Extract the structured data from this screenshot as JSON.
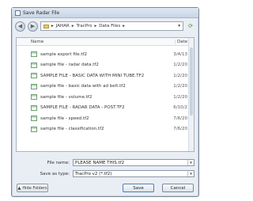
{
  "window": {
    "title": "Save Radar File"
  },
  "navbar": {
    "back_glyph": "◀",
    "forward_glyph": "▶",
    "breadcrumb": [
      "JAHAR",
      "TracPro",
      "Data Files"
    ],
    "separator": "▸",
    "dropdown_glyph": "▾",
    "refresh_glyph": "⟳"
  },
  "list": {
    "columns": {
      "name": "Name",
      "date": "Date"
    },
    "files": [
      {
        "name": "sample export file.tf2",
        "date": "3/4/13"
      },
      {
        "name": "sample file - radar data.tf2",
        "date": "1/2/20"
      },
      {
        "name": "SAMPLE FILE - BASIC DATA WITH MINI TUBE.TF2",
        "date": "1/2/20"
      },
      {
        "name": "sample file - basic data with ad belt.tf2",
        "date": "1/2/20"
      },
      {
        "name": "sample file - volume.tf2",
        "date": "1/2/20"
      },
      {
        "name": "SAMPLE FILE - RADAR DATA - POST.TF2",
        "date": "6/10/2"
      },
      {
        "name": "sample file - speed.tf2",
        "date": "7/6/20"
      },
      {
        "name": "sample file - classification.tf2",
        "date": "7/6/20"
      }
    ]
  },
  "form": {
    "filename_label": "File name:",
    "filename_value": "PLEASE NAME THIS.tf2",
    "savetype_label": "Save as type:",
    "savetype_value": "TracPro v2 (*.tf2)"
  },
  "buttons": {
    "hide_folders": "Hide Folders",
    "hide_glyph": "▲",
    "save": "Save",
    "cancel": "Cancel"
  }
}
